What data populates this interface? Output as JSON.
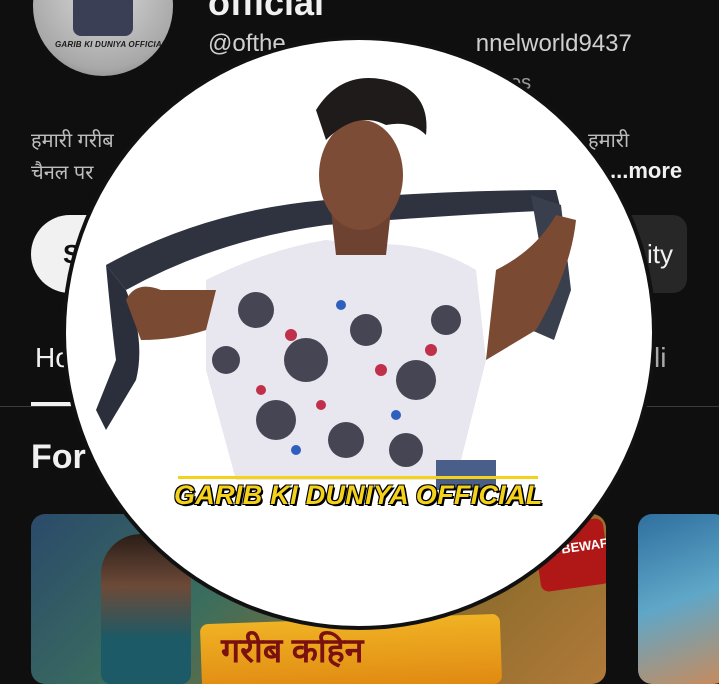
{
  "channel": {
    "title": "official",
    "handle_start": "@ofthe",
    "handle_end": "nnelworld9437",
    "meta": "os",
    "description_line1_start": "हमारी गरीब",
    "description_line1_end": "हमारी",
    "description_line2": "चैनल पर",
    "more": "...more",
    "avatar_logo": "GARIB KI DUNIYA OFFICIAL"
  },
  "actions": {
    "subscribe_label": "S",
    "community_label": "ity"
  },
  "tabs": {
    "home": "Ho",
    "playlists": "yli"
  },
  "sections": {
    "for_you": "For"
  },
  "thumbnails": [
    {
      "title_text": "गरीब कहिन",
      "badge": "SI BEWAFA SONG"
    },
    {
      "title_text": ""
    }
  ],
  "overlay": {
    "logo_text": "GARIB KI DUNIYA OFFICIAL"
  },
  "colors": {
    "background": "#0f0f0f",
    "logo_yellow": "#f5d21a",
    "overlay_bg": "#ffffff"
  }
}
